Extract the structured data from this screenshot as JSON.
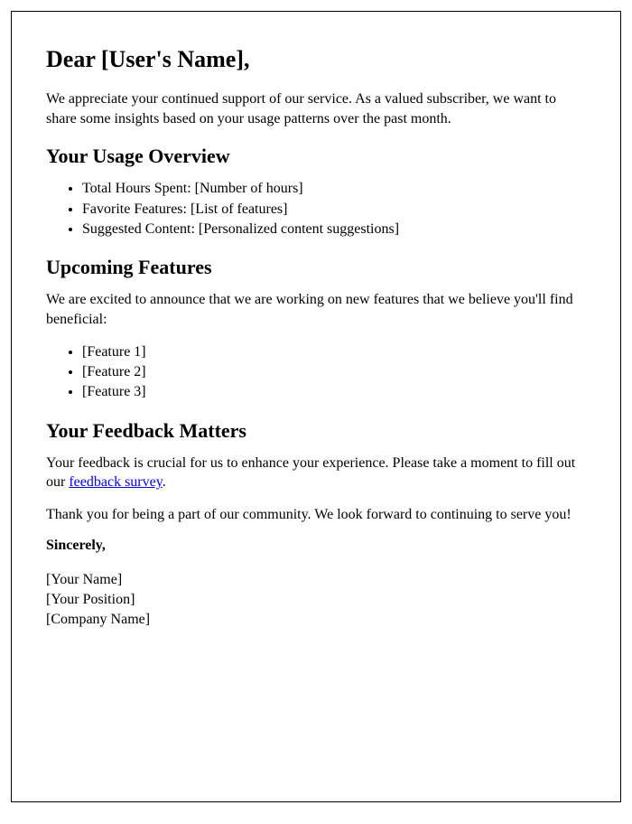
{
  "greeting": "Dear [User's Name],",
  "intro": "We appreciate your continued support of our service. As a valued subscriber, we want to share some insights based on your usage patterns over the past month.",
  "usage_heading": "Your Usage Overview",
  "usage_items": [
    "Total Hours Spent: [Number of hours]",
    "Favorite Features: [List of features]",
    "Suggested Content: [Personalized content suggestions]"
  ],
  "upcoming_heading": "Upcoming Features",
  "upcoming_intro": "We are excited to announce that we are working on new features that we believe you'll find beneficial:",
  "upcoming_items": [
    "[Feature 1]",
    "[Feature 2]",
    "[Feature 3]"
  ],
  "feedback_heading": "Your Feedback Matters",
  "feedback_text_before": "Your feedback is crucial for us to enhance your experience. Please take a moment to fill out our ",
  "feedback_link_text": "feedback survey",
  "feedback_text_after": ".",
  "thank_you": "Thank you for being a part of our community. We look forward to continuing to serve you!",
  "closing": "Sincerely,",
  "signature": {
    "name": "[Your Name]",
    "position": "[Your Position]",
    "company": "[Company Name]"
  }
}
